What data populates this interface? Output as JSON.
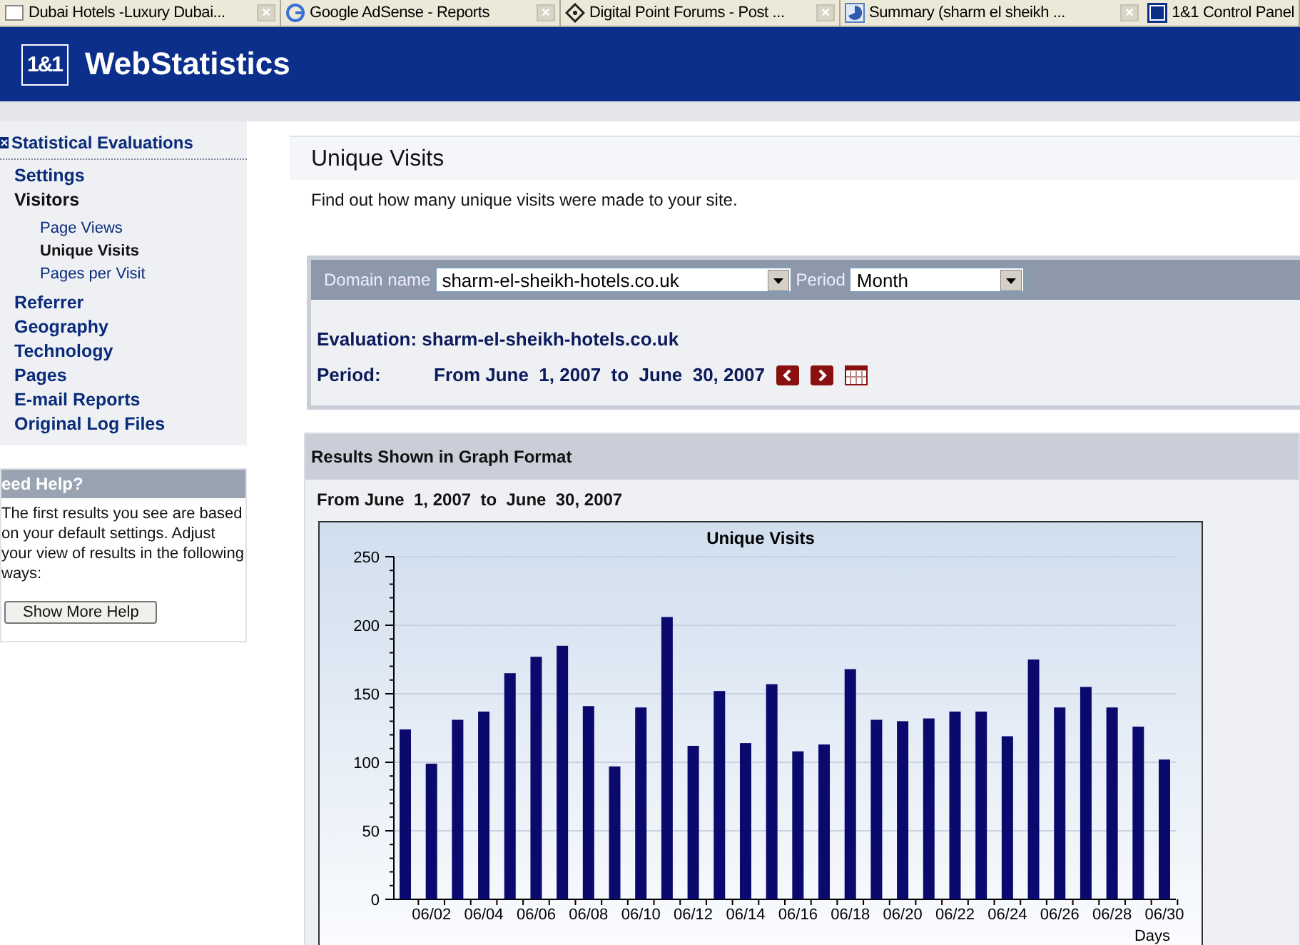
{
  "browser_tabs": [
    {
      "title": "Dubai Hotels -Luxury Dubai..."
    },
    {
      "title": "Google AdSense - Reports"
    },
    {
      "title": "Digital Point Forums - Post ..."
    },
    {
      "title": "Summary (sharm el sheikh ..."
    },
    {
      "title": "1&1 Control Panel"
    }
  ],
  "header": {
    "logo": "1&1",
    "title": "WebStatistics"
  },
  "sidebar": {
    "heading": "Statistical Evaluations",
    "items": [
      {
        "label": "Settings",
        "expanded": false
      },
      {
        "label": "Visitors",
        "expanded": true,
        "children": [
          {
            "label": "Page Views",
            "selected": false
          },
          {
            "label": "Unique Visits",
            "selected": true
          },
          {
            "label": "Pages per Visit",
            "selected": false
          }
        ]
      },
      {
        "label": "Referrer",
        "expanded": false
      },
      {
        "label": "Geography",
        "expanded": false
      },
      {
        "label": "Technology",
        "expanded": false
      },
      {
        "label": "Pages",
        "expanded": false
      },
      {
        "label": "E-mail Reports",
        "expanded": false
      },
      {
        "label": "Original Log Files",
        "expanded": false
      }
    ]
  },
  "help": {
    "title": "eed Help?",
    "text": "The first results you see are based on your default settings. Adjust your view of results in the following ways:",
    "button": "Show More Help"
  },
  "page": {
    "title": "Unique Visits",
    "description": "Find out how many unique visits were made to your site."
  },
  "filter": {
    "domain_label": "Domain name",
    "domain_value": "sharm-el-sheikh-hotels.co.uk",
    "period_label": "Period",
    "period_value": "Month"
  },
  "evaluation": {
    "label": "Evaluation:",
    "value": "sharm-el-sheikh-hotels.co.uk"
  },
  "period": {
    "label": "Period:",
    "value": "From June  1, 2007  to  June  30, 2007"
  },
  "results": {
    "title": "Results Shown in Graph Format",
    "range": "From June  1, 2007  to  June  30, 2007",
    "chart_data": {
      "type": "bar",
      "title": "Unique Visits",
      "xlabel": "Days",
      "categories": [
        null,
        "06/02",
        null,
        "06/04",
        null,
        "06/06",
        null,
        "06/08",
        null,
        "06/10",
        null,
        "06/12",
        null,
        "06/14",
        null,
        "06/16",
        null,
        "06/18",
        null,
        "06/20",
        null,
        "06/22",
        null,
        "06/24",
        null,
        "06/26",
        null,
        "06/28",
        null,
        "06/30"
      ],
      "values": [
        124,
        99,
        131,
        137,
        165,
        177,
        185,
        141,
        97,
        140,
        206,
        112,
        152,
        114,
        157,
        108,
        113,
        168,
        131,
        130,
        132,
        137,
        137,
        119,
        175,
        140,
        155,
        140,
        126,
        102
      ],
      "ylim": [
        0,
        250
      ],
      "yticks": [
        0,
        50,
        100,
        150,
        200,
        250
      ],
      "grid": true
    }
  }
}
